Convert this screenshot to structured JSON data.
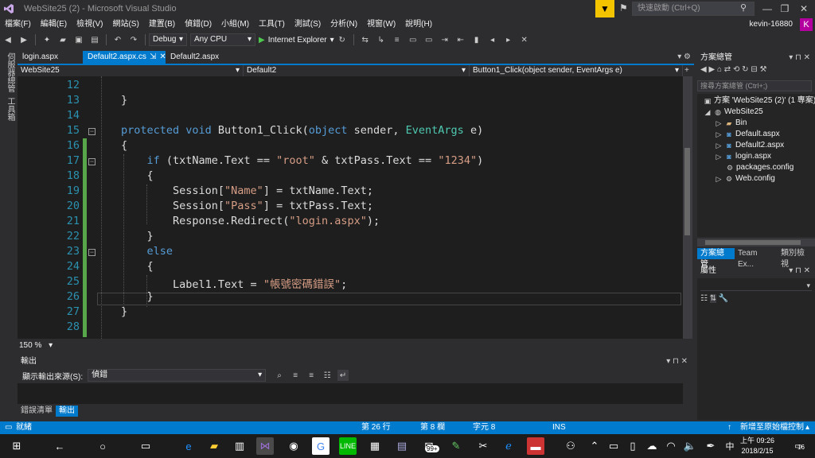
{
  "window": {
    "title": "WebSite25 (2) - Microsoft Visual Studio"
  },
  "quick_launch": {
    "placeholder": "快速啟動 (Ctrl+Q)"
  },
  "menu": [
    "檔案(F)",
    "編輯(E)",
    "檢視(V)",
    "網站(S)",
    "建置(B)",
    "偵錯(D)",
    "小組(M)",
    "工具(T)",
    "測試(S)",
    "分析(N)",
    "視窗(W)",
    "說明(H)"
  ],
  "account": {
    "name": "kevin-16880",
    "avatar": "K"
  },
  "toolbar": {
    "config": "Debug",
    "platform": "Any CPU",
    "run_label": "Internet Explorer"
  },
  "left_strip": {
    "server_explorer": "伺服器總管",
    "toolbox": "工具箱"
  },
  "doc_tabs": [
    {
      "label": "login.aspx",
      "active": false,
      "pinned": false
    },
    {
      "label": "Default2.aspx.cs",
      "active": true,
      "pinned": true
    },
    {
      "label": "Default2.aspx",
      "active": false,
      "pinned": false
    }
  ],
  "nav": {
    "project": "WebSite25",
    "class": "Default2",
    "member": "Button1_Click(object sender, EventArgs e)"
  },
  "code": {
    "line_numbers": [
      "12",
      "13",
      "14",
      "15",
      "16",
      "17",
      "18",
      "19",
      "20",
      "21",
      "22",
      "23",
      "24",
      "25",
      "26",
      "27",
      "28"
    ]
  },
  "zoom": {
    "level": "150 %"
  },
  "output": {
    "title": "輸出",
    "source_label": "顯示輸出來源(S):",
    "source_value": "偵錯"
  },
  "bottom_tabs": [
    "錯誤清單",
    "輸出"
  ],
  "solution_explorer": {
    "title": "方案總管",
    "search_placeholder": "搜尋方案總管 (Ctrl+;)",
    "solution": "方案 'WebSite25 (2)' (1 專案)",
    "project": "WebSite25",
    "items": [
      "Bin",
      "Default.aspx",
      "Default2.aspx",
      "login.aspx",
      "packages.config",
      "Web.config"
    ],
    "tabs": [
      "方案總管",
      "Team Ex...",
      "類別檢視"
    ]
  },
  "properties": {
    "title": "屬性"
  },
  "status": {
    "ready": "就緒",
    "line": "第 26 行",
    "col": "第 8 欄",
    "ch": "字元 8",
    "mode": "INS",
    "source_control": "新增至原始檔控制"
  },
  "taskbar": {
    "time": "上午 09:26",
    "date": "2018/2/15",
    "ime": "中",
    "badge": "99+",
    "notif_count": "16"
  }
}
